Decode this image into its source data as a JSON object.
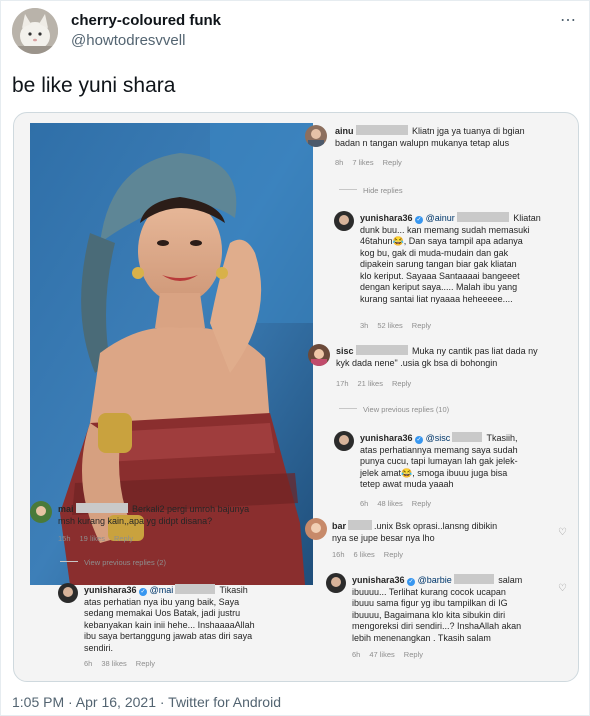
{
  "tweet": {
    "display_name": "cherry-coloured funk",
    "handle": "@howtodresvvell",
    "text": "be like yuni shara",
    "more_icon": "⋯",
    "footer": "1:05 PM · Apr 16, 2021 · Twitter for Android"
  },
  "media": {
    "comments": [
      {
        "user": "ainu",
        "lines": [
          "Kliatn jga ya tuanya di bgian",
          "badan n tangan walupn mukanya tetap alus"
        ],
        "meta": {
          "time": "8h",
          "likes": "7 likes",
          "reply": "Reply"
        }
      },
      {
        "hide": "Hide replies"
      },
      {
        "user": "yunishara36",
        "mention": "@ainur",
        "lines": [
          "Kliatan",
          "dunk buu... kan memang sudah memasuki",
          "46tahun😂, Dan saya tampil apa adanya",
          "kog bu, gak di muda-mudain dan gak",
          "dipakein sarung tangan biar gak kliatan",
          "klo keriput.  Sayaaa Santaaaai bangeeet",
          "dengan keriput saya..... Malah ibu yang",
          "kurang santai liat nyaaaa heheeeee...."
        ],
        "meta": {
          "time": "3h",
          "likes": "52 likes",
          "reply": "Reply"
        }
      },
      {
        "user": "sisc",
        "lines": [
          "Muka ny cantik pas liat dada ny",
          "kyk dada nene\" .usia gk bsa di bohongin"
        ],
        "meta": {
          "time": "17h",
          "likes": "21 likes",
          "reply": "Reply"
        }
      },
      {
        "view_prev": "View previous replies (10)"
      },
      {
        "user": "yunishara36",
        "mention": "@sisc",
        "lines": [
          "Tkasiih,",
          "atas perhatiannya memang saya sudah",
          "punya cucu, tapi lumayan lah gak jelek-",
          "jelek amat😂, smoga ibuuu juga bisa",
          "tetep awat muda yaaah"
        ],
        "meta": {
          "time": "6h",
          "likes": "48 likes",
          "reply": "Reply"
        }
      },
      {
        "user": "mai",
        "lines": [
          "Berkali2 pergi umroh bajunya",
          "msh kurang kain,,apa yg didpt disana?"
        ],
        "meta": {
          "time": "15h",
          "likes": "19 likes",
          "reply": "Reply"
        }
      },
      {
        "view_prev": "View previous replies (2)"
      },
      {
        "user": "yunishara36",
        "mention": "@mai",
        "lines": [
          "Tikasih",
          "atas perhatian nya ibu yang baik,  Saya",
          "sedang memakai Uos Batak, jadi justru",
          "kebanyakan kain inii hehe... InshaaaaAllah",
          "ibu saya bertanggung jawab atas diri saya",
          "sendiri."
        ],
        "meta": {
          "time": "6h",
          "likes": "38 likes",
          "reply": "Reply"
        }
      },
      {
        "user": "bar",
        "handle_tail": ".unix",
        "lines": [
          "Bsk oprasi..lansng dibikin",
          "nya se jupe besar nya lho"
        ],
        "meta": {
          "time": "16h",
          "likes": "6 likes",
          "reply": "Reply"
        }
      },
      {
        "user": "yunishara36",
        "mention": "@barbie",
        "lines": [
          "salam",
          "ibuuuu...  Terlihat kurang cocok ucapan",
          "ibuuu sama figur yg ibu tampilkan di IG",
          "ibuuuu, Bagaimana klo kita sibukin diri",
          "mengoreksi diri sendiri...? InshaAllah akan",
          "lebih menenangkan . Tkasih salam"
        ],
        "meta": {
          "time": "6h",
          "likes": "47 likes",
          "reply": "Reply"
        }
      }
    ]
  }
}
